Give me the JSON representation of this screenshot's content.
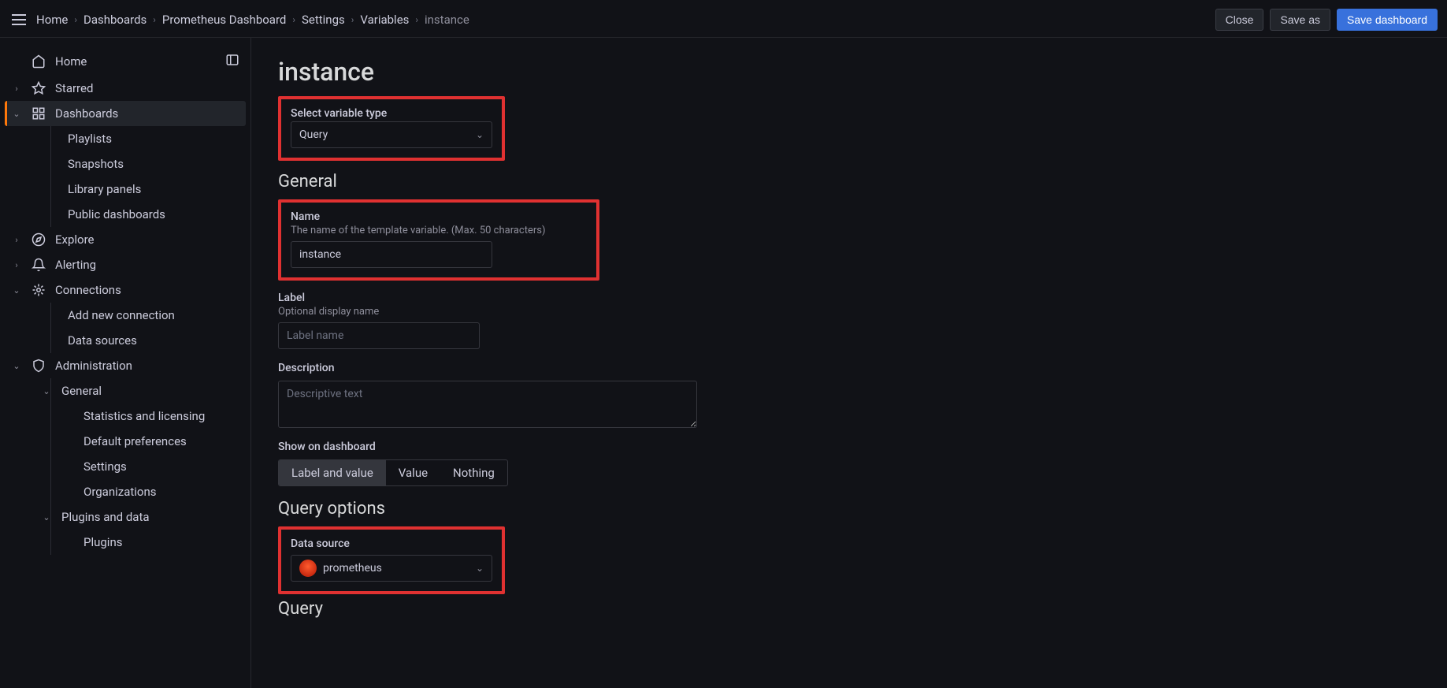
{
  "breadcrumbs": [
    "Home",
    "Dashboards",
    "Prometheus Dashboard",
    "Settings",
    "Variables",
    "instance"
  ],
  "actions": {
    "close": "Close",
    "save_as": "Save as",
    "save": "Save dashboard"
  },
  "sidebar": {
    "home": "Home",
    "starred": "Starred",
    "dashboards": "Dashboards",
    "playlists": "Playlists",
    "snapshots": "Snapshots",
    "library_panels": "Library panels",
    "public_dashboards": "Public dashboards",
    "explore": "Explore",
    "alerting": "Alerting",
    "connections": "Connections",
    "add_conn": "Add new connection",
    "data_sources": "Data sources",
    "administration": "Administration",
    "general": "General",
    "stats": "Statistics and licensing",
    "defaults": "Default preferences",
    "settings": "Settings",
    "orgs": "Organizations",
    "plugins_data": "Plugins and data",
    "plugins": "Plugins"
  },
  "page": {
    "title": "instance",
    "type_label": "Select variable type",
    "type_value": "Query",
    "general_heading": "General",
    "name_label": "Name",
    "name_hint": "The name of the template variable. (Max. 50 characters)",
    "name_value": "instance",
    "label_label": "Label",
    "label_hint": "Optional display name",
    "label_placeholder": "Label name",
    "desc_label": "Description",
    "desc_placeholder": "Descriptive text",
    "show_label": "Show on dashboard",
    "show_opt1": "Label and value",
    "show_opt2": "Value",
    "show_opt3": "Nothing",
    "query_heading": "Query options",
    "ds_label": "Data source",
    "ds_value": "prometheus",
    "query_label": "Query"
  }
}
